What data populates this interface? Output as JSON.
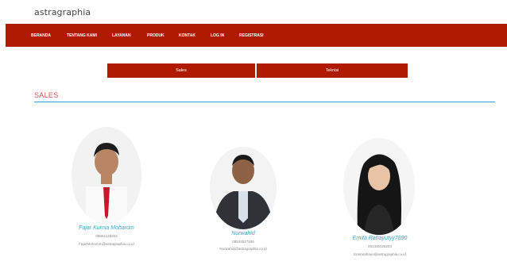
{
  "brand": {
    "logo_text": "astragraphia"
  },
  "nav": {
    "items": [
      "BERANDA",
      "TENTANG KAMI",
      "LAYANAN",
      "PRODUK",
      "KONTAK",
      "LOG IN",
      "REGISTRASI"
    ]
  },
  "tabs": {
    "sales": "Sales",
    "teknisi": "Teknisi"
  },
  "section": {
    "title": "SALES"
  },
  "people": [
    {
      "name": "Fajar Kurnia Moharom",
      "phone": "08561128202",
      "email": "FajarMoharom@astragraphia.co.id"
    },
    {
      "name": "Nurwahid",
      "phone": "08534527165",
      "email": "Nurwahid@astragraphia.co.id"
    },
    {
      "name": "Ernita Rahayutyy7890",
      "phone": "081346326253",
      "email": "Ernitarahayu@astragraphia.co.id"
    }
  ],
  "colors": {
    "navbar": "#b01a02",
    "accent_text": "#3aa6c8",
    "section_title": "#d9534f",
    "rule": "#3a9fd8"
  }
}
